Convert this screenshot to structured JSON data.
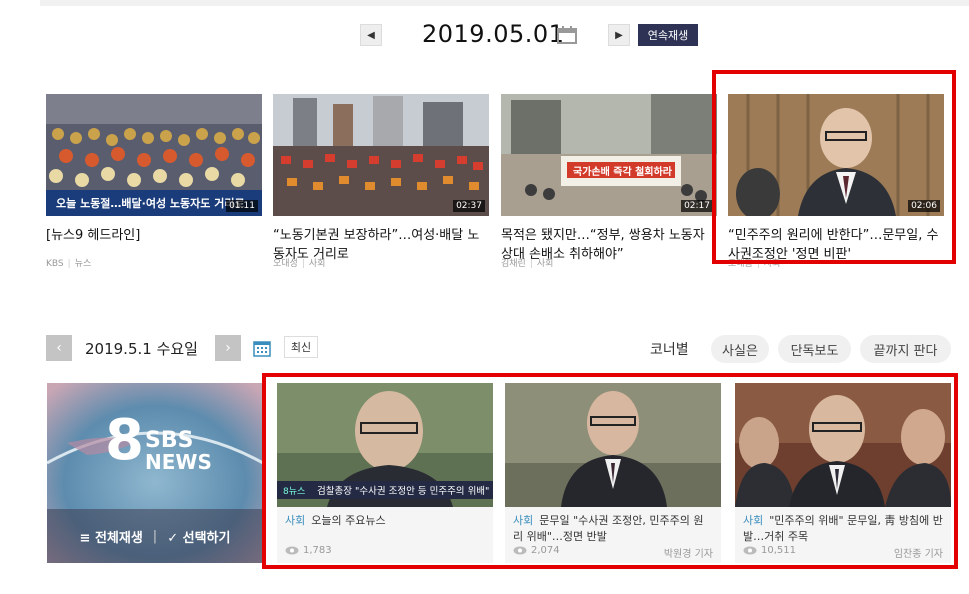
{
  "date_nav": {
    "prev_icon": "chevron-left-icon",
    "date": "2019.05.01",
    "calendar_icon": "calendar-icon",
    "next_icon": "chevron-right-icon",
    "continuous_play_label": "연속재생"
  },
  "top_cards": [
    {
      "duration": "01:11",
      "title": "[뉴스9 헤드라인]",
      "source": "KBS",
      "category": "뉴스",
      "caption": "오늘 노동절…배달·여성 노동자도 거리로"
    },
    {
      "duration": "02:37",
      "title": "“노동기본권 보장하라”…여성·배달 노동자도 거리로",
      "source": "오대성",
      "category": "사회"
    },
    {
      "duration": "02:17",
      "title": "목적은 됐지만…“정부, 쌍용차 노동자 상대 손배소 취하해야”",
      "source": "김채린",
      "category": "사회",
      "banner": "국가손배 즉각 철회하라"
    },
    {
      "duration": "02:06",
      "title": "“민주주의 원리에 반한다”…문무일, 수사권조정안 '정면 비판'",
      "source": "조태흠",
      "category": "사회"
    }
  ],
  "section2": {
    "date": "2019.5.1 수요일",
    "latest_label": "최신",
    "corner_label": "코너별",
    "pills": [
      "사실은",
      "단독보도",
      "끝까지 판다"
    ]
  },
  "sbs_tile": {
    "logo_number": "8",
    "logo_sbs": "SBS",
    "logo_news": "NEWS",
    "play_all_label": "전체재생",
    "select_label": "선택하기"
  },
  "video_cards": [
    {
      "category": "사회",
      "title": "오늘의 주요뉴스",
      "views": "1,783",
      "reporter": "",
      "caption": "검찰총장 \"수사권 조정안 등 민주주의 위배\"",
      "caption_tag": "8뉴스"
    },
    {
      "category": "사회",
      "title": "문무일 \"수사권 조정안, 민주주의 원리 위배\"…정면 반발",
      "views": "2,074",
      "reporter": "박원경 기자"
    },
    {
      "category": "사회",
      "title": "\"민주주의 위배\" 문무일, 靑 방침에 반발…거취 주목",
      "views": "10,511",
      "reporter": "임찬종 기자"
    }
  ],
  "colors": {
    "highlight": "#e30000",
    "play_button": "#2e3355",
    "category_blue": "#3a8ebd"
  }
}
